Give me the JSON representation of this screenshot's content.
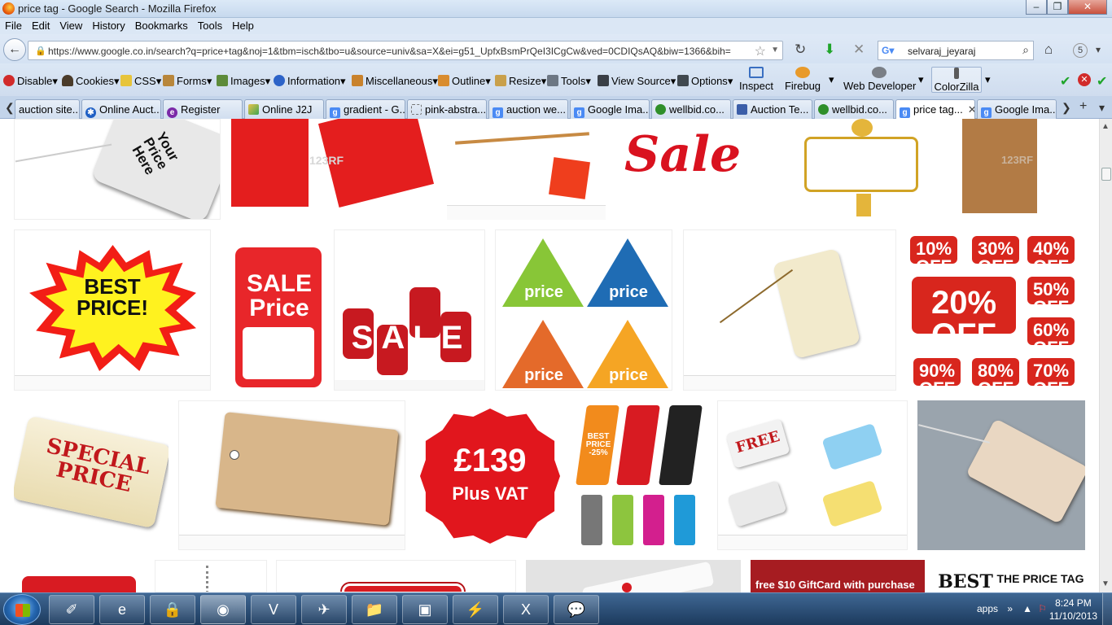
{
  "window": {
    "title": "price tag - Google Search - Mozilla Firefox",
    "min": "–",
    "max": "❐",
    "close": "✕"
  },
  "menu": [
    "File",
    "Edit",
    "View",
    "History",
    "Bookmarks",
    "Tools",
    "Help"
  ],
  "nav": {
    "url": "https://www.google.co.in/search?q=price+tag&noj=1&tbm=isch&tbo=u&source=univ&sa=X&ei=g51_UpfxBsmPrQeI3ICgCw&ved=0CDIQsAQ&biw=1366&bih=",
    "search_user": "selvaraj_jeyaraj",
    "badge": "5"
  },
  "toolbar": {
    "items": [
      "Disable",
      "Cookies",
      "CSS",
      "Forms",
      "Images",
      "Information",
      "Miscellaneous",
      "Outline",
      "Resize",
      "Tools",
      "View Source",
      "Options"
    ],
    "tools2": [
      "Inspect",
      "Firebug",
      "Web Developer",
      "ColorZilla"
    ]
  },
  "tabs": [
    {
      "label": "auction site..."
    },
    {
      "label": "Online Auct..."
    },
    {
      "label": "Register"
    },
    {
      "label": "Online J2J"
    },
    {
      "label": "gradient - G..."
    },
    {
      "label": "pink-abstra..."
    },
    {
      "label": "auction we..."
    },
    {
      "label": "Google Ima..."
    },
    {
      "label": "wellbid.co..."
    },
    {
      "label": "Auction Te..."
    },
    {
      "label": "wellbid.co..."
    },
    {
      "label": "price tag..."
    },
    {
      "label": "Google Ima..."
    }
  ],
  "images": {
    "r1": [
      "Your Price Here",
      "123RF",
      "",
      "Sale",
      "",
      "123RF"
    ],
    "r2": [
      "BEST PRICE!",
      "SALE Price",
      "SALE",
      "price",
      "",
      "10% OFF",
      "30% OFF",
      "40% OFF",
      "20% OFF",
      "50% OFF",
      "60% OFF",
      "90% OFF",
      "80% OFF",
      "70% OFF"
    ],
    "r3": [
      "SPECIAL PRICE",
      "",
      "£139",
      "Plus VAT",
      "BEST PRICE -25%",
      "FREE",
      ""
    ],
    "r4": [
      "",
      "",
      "",
      "",
      "free $10 GiftCard with purchase",
      "BEST",
      "THE PRICE TAG"
    ]
  },
  "taskbar": {
    "apps": "apps",
    "time": "8:24 PM",
    "date": "11/10/2013"
  }
}
